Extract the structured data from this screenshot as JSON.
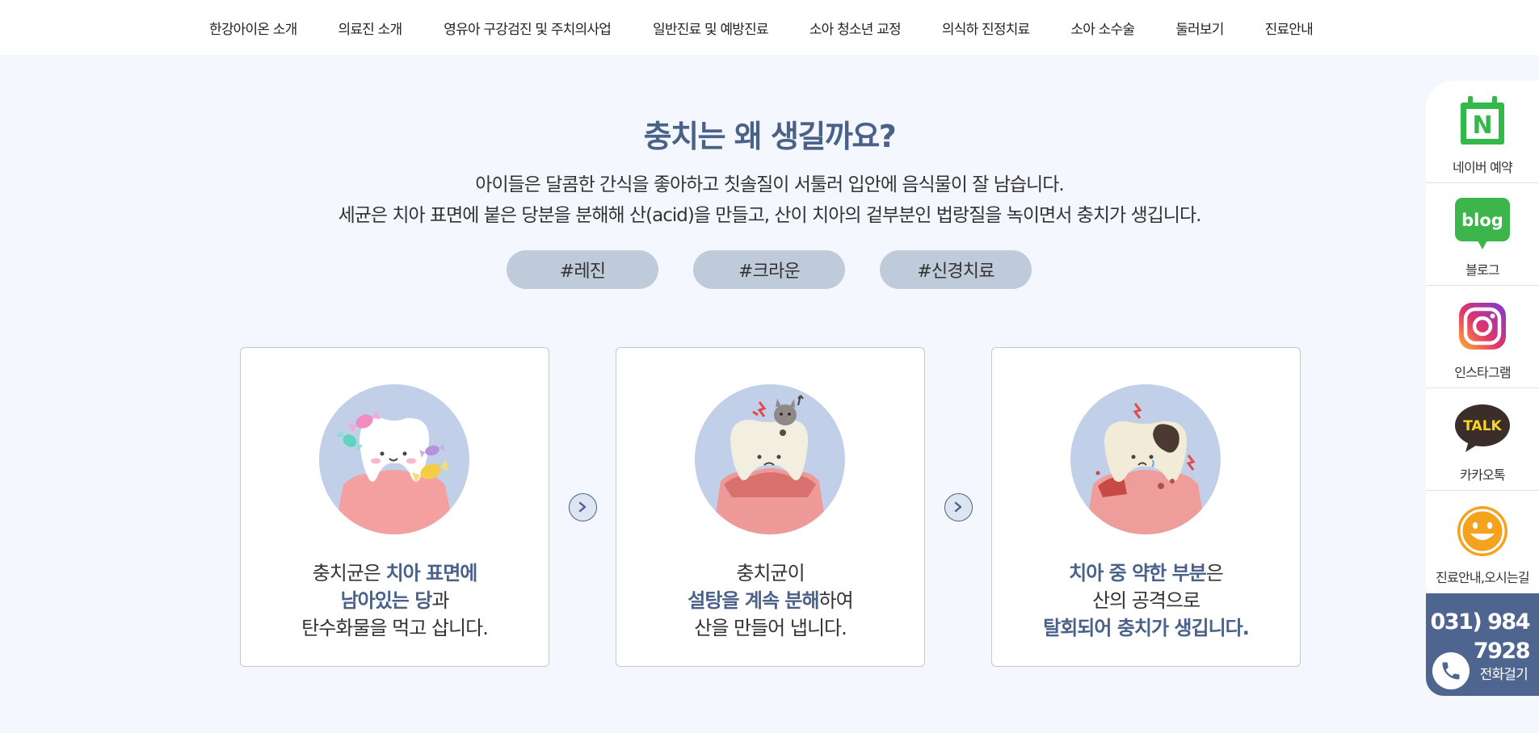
{
  "nav": {
    "items": [
      "한강아이온 소개",
      "의료진 소개",
      "영유아 구강검진 및 주치의사업",
      "일반진료 및 예방진료",
      "소아 청소년 교정",
      "의식하 진정치료",
      "소아 소수술",
      "둘러보기",
      "진료안내"
    ]
  },
  "section": {
    "title": "충치는 왜 생길까요?",
    "desc_line1": "아이들은 달콤한 간식을 좋아하고 칫솔질이 서툴러 입안에 음식물이 잘 남습니다.",
    "desc_line2": "세균은 치아 표면에 붙은 당분을 분해해 산(acid)을 만들고, 산이 치아의 겉부분인 법랑질을 녹이면서 충치가 생깁니다.",
    "tags": [
      "#레진",
      "#크라운",
      "#신경치료"
    ]
  },
  "steps": [
    {
      "p1": "충치균은 ",
      "h1": "치아 표면에",
      "h2": "남아있는 당",
      "p2": "과",
      "p3": "탄수화물을 먹고 삽니다."
    },
    {
      "p1": "충치균이",
      "h1": "설탕을 계속 분해",
      "p2": "하여",
      "p3": "산을 만들어 냅니다."
    },
    {
      "h1": "치아 중 약한 부분",
      "p1": "은",
      "p2": "산의 공격으로",
      "h2": "탈회되어 충치가 생깁니다."
    }
  ],
  "quick_menu": {
    "items": [
      {
        "label": "네이버 예약",
        "icon": "naver-calendar-icon"
      },
      {
        "label": "블로그",
        "icon": "blog-icon"
      },
      {
        "label": "인스타그램",
        "icon": "instagram-icon"
      },
      {
        "label": "카카오톡",
        "icon": "kakaotalk-icon"
      },
      {
        "label": "진료안내,오시는길",
        "icon": "smile-icon"
      }
    ],
    "blog_text": "blog",
    "talk_text": "TALK",
    "naver_letter": "N",
    "phone_line1": "031) 984",
    "phone_line2": "7928",
    "phone_label": "전화걸기"
  },
  "colors": {
    "accent": "#4a6189",
    "tag_bg": "#bfcadb",
    "circle_bg": "#c1cfe8",
    "page_bg": "#f4f7fd",
    "phone_bg": "#4e6590"
  }
}
